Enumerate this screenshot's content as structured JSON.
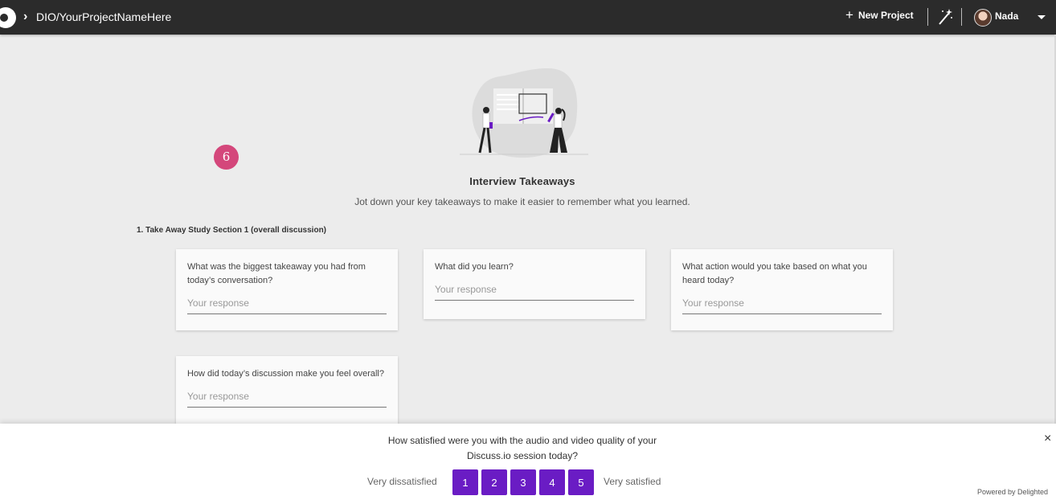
{
  "header": {
    "breadcrumb": "DIO/YourProjectNameHere",
    "new_project_label": "New Project",
    "user_name": "Nada"
  },
  "main": {
    "step_badge": "6",
    "title": "Interview Takeaways",
    "subtitle": "Jot down your key takeaways to make it easier to remember what you learned.",
    "section_title": "1. Take Away Study Section 1 (overall discussion)",
    "cards": [
      {
        "question": "What was the biggest takeaway you had from today’s conversation?",
        "placeholder": "Your response"
      },
      {
        "question": "What did you learn?",
        "placeholder": "Your response"
      },
      {
        "question": "What action would you take based on what you heard today?",
        "placeholder": "Your response"
      },
      {
        "question": "How did today’s discussion make you feel overall?",
        "placeholder": "Your response"
      }
    ]
  },
  "survey": {
    "question_line1": "How satisfied were you with the audio and video quality of your",
    "question_line2": "Discuss.io session today?",
    "low_label": "Very dissatisfied",
    "high_label": "Very satisfied",
    "options": [
      "1",
      "2",
      "3",
      "4",
      "5"
    ],
    "powered_by": "Powered by Delighted",
    "close_symbol": "×"
  },
  "colors": {
    "topbar": "#2b2b2b",
    "badge": "#d4477b",
    "rating_button": "#6a1cc4"
  }
}
